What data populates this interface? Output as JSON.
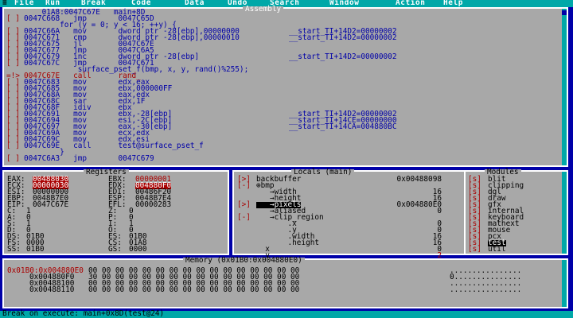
{
  "menu": {
    "items": [
      "File",
      "Run",
      "Break",
      "Code",
      "Data",
      "Undo",
      "Search",
      "Window",
      "Action",
      "Help"
    ]
  },
  "assembly": {
    "title": "Assembly",
    "lines": [
      {
        "mark": "",
        "text": "    01A8:0047C67E   main+8D"
      },
      {
        "mark": "[ ]",
        "text": "0047C668   jmp       0047C65D"
      },
      {
        "mark": "",
        "text": "        for (y = 0; y < 16; ++y) {"
      },
      {
        "mark": "[ ]",
        "text": "0047C66A   mov       dword ptr -28[ebp],00000000           __start_TI+14D2=00000002"
      },
      {
        "mark": "[ ]",
        "text": "0047C671   cmp       dword ptr -28[ebp],00000010           __start_TI+14D2=00000002"
      },
      {
        "mark": "[ ]",
        "text": "0047C675   jl        0047C67E"
      },
      {
        "mark": "[ ]",
        "text": "0047C677   jmp       0047C6A5"
      },
      {
        "mark": "[ ]",
        "text": "0047C679   inc       dword ptr -28[ebp]                    __start_TI+14D2=00000002"
      },
      {
        "mark": "[ ]",
        "text": "0047C67C   jmp       0047C671"
      },
      {
        "mark": "",
        "text": "            surface_pset_f(bmp, x, y, rand()%255);"
      },
      {
        "mark": "=!>",
        "text": "0047C67E   call      rand_",
        "current": true
      },
      {
        "mark": "[ ]",
        "text": "0047C683   mov       edx,eax"
      },
      {
        "mark": "[ ]",
        "text": "0047C685   mov       ebx,000000FF"
      },
      {
        "mark": "[ ]",
        "text": "0047C68A   mov       eax,edx"
      },
      {
        "mark": "[ ]",
        "text": "0047C68C   sar       edx,1F"
      },
      {
        "mark": "[ ]",
        "text": "0047C68F   idiv      ebx"
      },
      {
        "mark": "[ ]",
        "text": "0047C691   mov       ebx,-28[ebp]                          __start_TI+14D2=00000002"
      },
      {
        "mark": "[ ]",
        "text": "0047C694   mov       esi,-2C[ebp]                          __start_TI+14CE=00000000"
      },
      {
        "mark": "[ ]",
        "text": "0047C697   mov       eax,-30[ebp]                          __start_TI+14CA=004880BC"
      },
      {
        "mark": "[ ]",
        "text": "0047C69A   mov       ecx,edx"
      },
      {
        "mark": "[ ]",
        "text": "0047C69C   mov       edx,esi"
      },
      {
        "mark": "[ ]",
        "text": "0047C69E   call      test@surface_pset_f"
      },
      {
        "mark": "",
        "text": "        }"
      },
      {
        "mark": "[ ]",
        "text": "0047C6A3   jmp       0047C679"
      }
    ]
  },
  "registers": {
    "title": "Registers",
    "rows": [
      {
        "l": "EAX:",
        "lv": "00488030",
        "lhl": true,
        "r": "EBX:",
        "rv": "00000001",
        "rhl": "text"
      },
      {
        "l": "ECX:",
        "lv": "00000030",
        "lhl": true,
        "r": "EDX:",
        "rv": "004880F0",
        "rhl": true
      },
      {
        "l": "ESI:",
        "lv": "00000000",
        "r": "EDI:",
        "rv": "00486F20"
      },
      {
        "l": "EBP:",
        "lv": "0048B7E0",
        "r": "ESP:",
        "rv": "0048B7E4"
      },
      {
        "l": "EIP:",
        "lv": "0047C67E",
        "r": "EFL:",
        "rv": "00000283"
      },
      {
        "l": "C:",
        "lv": "1",
        "r": "Z:",
        "rv": "0"
      },
      {
        "l": "A:",
        "lv": "0",
        "r": "P:",
        "rv": "0"
      },
      {
        "l": "S:",
        "lv": "1",
        "r": "I:",
        "rv": "1"
      },
      {
        "l": "D:",
        "lv": "0",
        "r": "O:",
        "rv": "0"
      },
      {
        "l": "DS:",
        "lv": "01B0",
        "r": "ES:",
        "rv": "01B0"
      },
      {
        "l": "FS:",
        "lv": "0000",
        "r": "CS:",
        "rv": "01A8"
      },
      {
        "l": "SS:",
        "lv": "01B0",
        "r": "GS:",
        "rv": "0000"
      }
    ]
  },
  "locals": {
    "title": "Locals (main)",
    "rows": [
      {
        "mark": "[>]",
        "name": "backbuffer",
        "value": "0x00488098"
      },
      {
        "mark": "[-]",
        "name": "⊕bmp",
        "value": ""
      },
      {
        "mark": "",
        "name": "   →width",
        "value": "16"
      },
      {
        "mark": "",
        "name": "   →height",
        "value": "16"
      },
      {
        "mark": "[>]",
        "name": "   →pixels",
        "value": "0x004880E0",
        "selected": true
      },
      {
        "mark": "",
        "name": "   →aliased",
        "value": "0"
      },
      {
        "mark": "[-]",
        "name": "   →clip_region",
        "value": ""
      },
      {
        "mark": "",
        "name": "       .x",
        "value": "0"
      },
      {
        "mark": "",
        "name": "       .y",
        "value": "0"
      },
      {
        "mark": "",
        "name": "       .width",
        "value": "16"
      },
      {
        "mark": "",
        "name": "       .height",
        "value": "16"
      },
      {
        "mark": "",
        "name": "  x",
        "value": "0"
      },
      {
        "mark": "",
        "name": "  y",
        "value": "2",
        "red": true
      }
    ]
  },
  "modules": {
    "title": "Modules",
    "items": [
      {
        "mark": "[s]",
        "name": "blit"
      },
      {
        "mark": "[s]",
        "name": "clipping"
      },
      {
        "mark": "[s]",
        "name": "dgl"
      },
      {
        "mark": "[s]",
        "name": "draw"
      },
      {
        "mark": "[s]",
        "name": "gfx"
      },
      {
        "mark": "[s]",
        "name": "internal"
      },
      {
        "mark": "[s]",
        "name": "keyboard"
      },
      {
        "mark": "[s]",
        "name": "mathext"
      },
      {
        "mark": "[s]",
        "name": "mouse"
      },
      {
        "mark": "[s]",
        "name": "pcx"
      },
      {
        "mark": "[s]",
        "name": "test",
        "selected": true
      },
      {
        "mark": "[s]",
        "name": "util"
      }
    ]
  },
  "memory": {
    "title": "Memory (0x01B0:0x004880E0)",
    "rows": [
      {
        "addr": "0x01B0:0x004880E0",
        "hex": "00 00 00 00 00 00 00 00 00 00 00 00 00 00 00 00",
        "ascii": "................",
        "cur": true
      },
      {
        "addr": "0x004880F0",
        "hex": "30 00 00 00 00 00 00 00 00 00 00 00 00 00 00 00",
        "ascii": "0..............."
      },
      {
        "addr": "0x00488100",
        "hex": "00 00 00 00 00 00 00 00 00 00 00 00 00 00 00 00",
        "ascii": "................"
      },
      {
        "addr": "0x00488110",
        "hex": "00 00 00 00 00 00 00 00 00 00 00 00 00 00 00 00",
        "ascii": "................"
      }
    ]
  },
  "status": {
    "text": "Break on execute: main+0x8D(test@24)"
  },
  "colors": {
    "background": "#0000a8",
    "panel": "#a8a8a8",
    "menubar": "#00a8a8",
    "highlight": "#a80000"
  }
}
